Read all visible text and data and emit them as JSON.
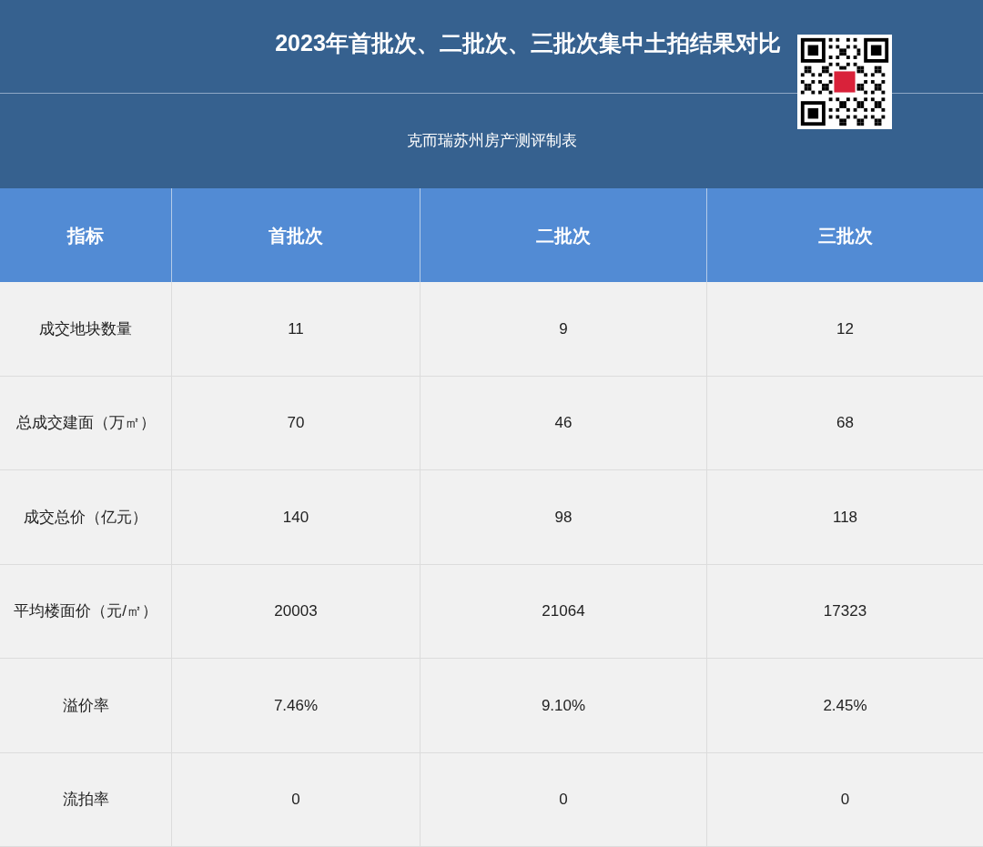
{
  "title": "2023年首批次、二批次、三批次集中土拍结果对比",
  "subtitle": "克而瑞苏州房产测评制表",
  "table": {
    "columns": [
      "指标",
      "首批次",
      "二批次",
      "三批次"
    ],
    "rows": [
      [
        "成交地块数量",
        "11",
        "9",
        "12"
      ],
      [
        "总成交建面（万㎡）",
        "70",
        "46",
        "68"
      ],
      [
        "成交总价（亿元）",
        "140",
        "98",
        "118"
      ],
      [
        "平均楼面价（元/㎡）",
        "20003",
        "21064",
        "17323"
      ],
      [
        "溢价率",
        "7.46%",
        "9.10%",
        "2.45%"
      ],
      [
        "流拍率",
        "0",
        "0",
        "0"
      ]
    ]
  }
}
